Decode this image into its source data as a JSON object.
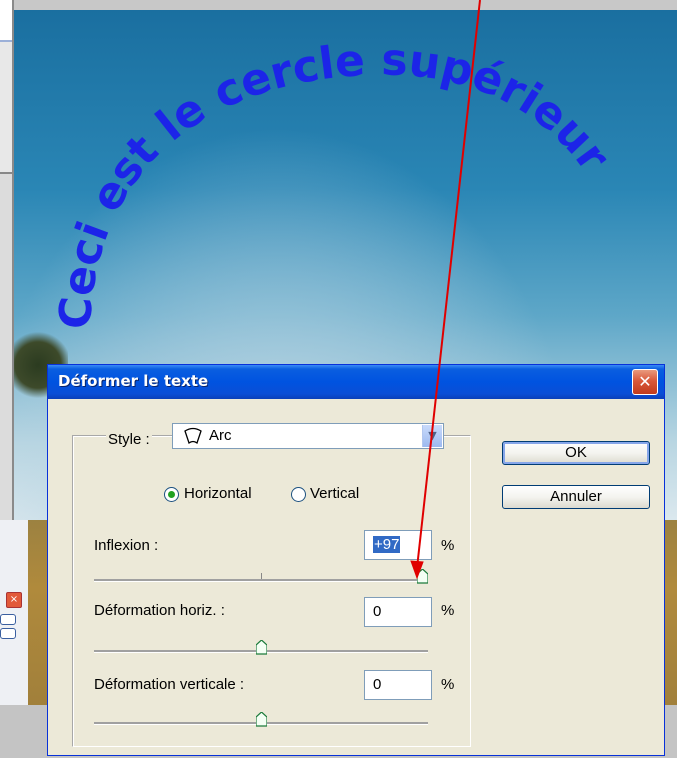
{
  "arc_text": "Ceci est le cercle supérieur",
  "dialog": {
    "title": "Déformer le texte",
    "close_icon": "close-icon",
    "style": {
      "label": "Style :",
      "value": "Arc",
      "icon": "arc-warp-icon"
    },
    "orientation": {
      "horizontal_label": "Horizontal",
      "vertical_label": "Vertical",
      "selected": "Horizontal"
    },
    "params": [
      {
        "label": "Inflexion :",
        "value": "+97",
        "unit": "%",
        "slider_fraction": 0.985
      },
      {
        "label": "Déformation horiz. :",
        "value": "0",
        "unit": "%",
        "slider_fraction": 0.5
      },
      {
        "label": "Déformation verticale :",
        "value": "0",
        "unit": "%",
        "slider_fraction": 0.5
      }
    ],
    "buttons": {
      "ok": "OK",
      "cancel": "Annuler"
    }
  },
  "colors": {
    "arc_text": "#1c24e8",
    "annotation_arrow": "#e00000",
    "titlebar": "#0053e0"
  }
}
